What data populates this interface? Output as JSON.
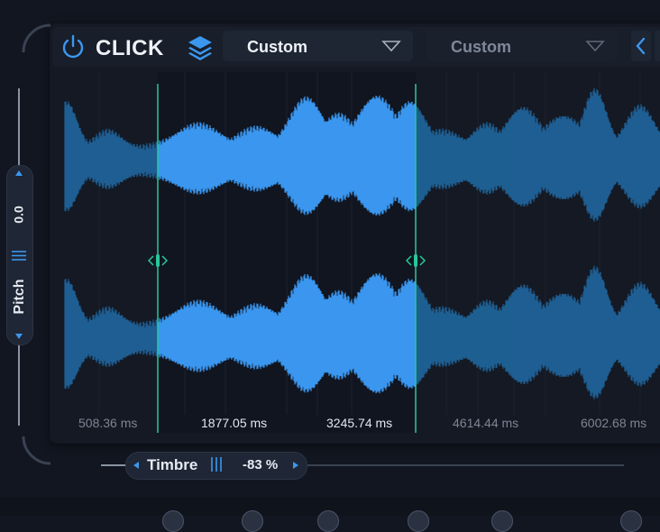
{
  "header": {
    "title": "CLICK",
    "preset_a": "Custom",
    "preset_b": "Custom"
  },
  "pitch": {
    "label": "Pitch",
    "value": "0.0"
  },
  "timbre": {
    "label": "Timbre",
    "value": "-83",
    "unit": "%"
  },
  "timeline": {
    "labels": [
      "508.36 ms",
      "1877.05 ms",
      "3245.74 ms",
      "4614.44 ms",
      "6002.68 ms"
    ]
  },
  "selection": {
    "start_ms": 1877.05,
    "end_ms": 3245.74
  },
  "colors": {
    "accent": "#3b97ee",
    "accent_dim": "#1f5f93",
    "marker": "#29c79a",
    "background": "#121620"
  },
  "icons": {
    "power": "power-icon",
    "layers": "layers-icon",
    "dropdown": "triangle-down-icon",
    "prev": "chevron-left-icon",
    "marker_handle": "drag-handle-icon"
  }
}
